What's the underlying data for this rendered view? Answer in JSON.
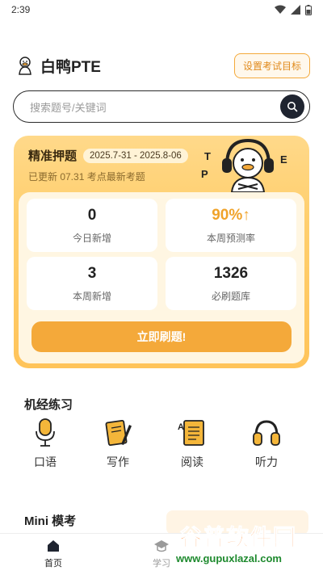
{
  "status": {
    "time": "2:39"
  },
  "header": {
    "title": "白鸭PTE",
    "target_button": "设置考试目标"
  },
  "search": {
    "placeholder": "搜索题号/关键词"
  },
  "prediction_card": {
    "title": "精准押题",
    "date_range": "2025.7-31 - 2025.8-06",
    "updated_text": "已更新 07.31 考点最新考题",
    "mascot_letters": [
      "T",
      "P",
      "E"
    ],
    "stats": [
      {
        "value": "0",
        "label": "今日新增"
      },
      {
        "value": "90%↑",
        "label": "本周预测率"
      },
      {
        "value": "3",
        "label": "本周新增"
      },
      {
        "value": "1326",
        "label": "必刷题库"
      }
    ],
    "cta": "立即刷题!"
  },
  "practice": {
    "title": "机经练习",
    "items": [
      {
        "label": "口语",
        "icon": "microphone-icon"
      },
      {
        "label": "写作",
        "icon": "notebook-pen-icon"
      },
      {
        "label": "阅读",
        "icon": "reading-doc-icon"
      },
      {
        "label": "听力",
        "icon": "headphones-icon"
      }
    ]
  },
  "mini_exam": {
    "title": "Mini 模考"
  },
  "tabbar": {
    "items": [
      {
        "label": "首页",
        "icon": "home-icon",
        "active": true
      },
      {
        "label": "学习",
        "icon": "graduation-cap-icon",
        "active": false
      }
    ]
  },
  "watermark": {
    "text": "谷普软件园",
    "url": "www.gupuxlazal.com"
  },
  "colors": {
    "accent": "#f4a93a",
    "card_bg": "#ffcf6e",
    "text": "#222222"
  }
}
